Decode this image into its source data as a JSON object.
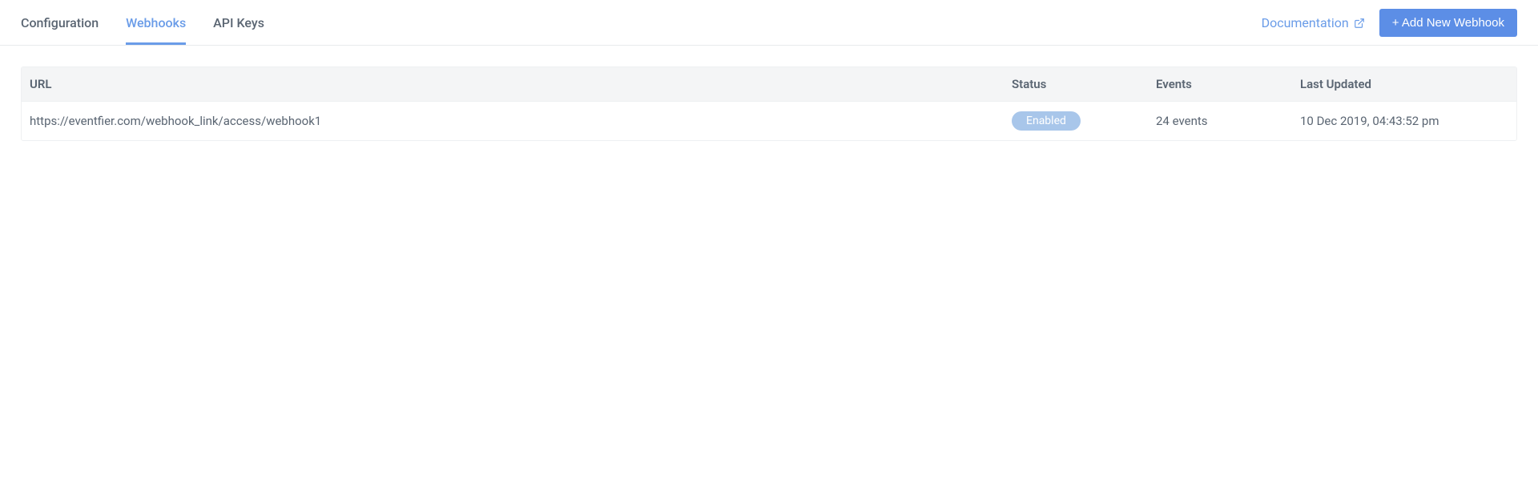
{
  "tabs": {
    "configuration": "Configuration",
    "webhooks": "Webhooks",
    "api_keys": "API Keys"
  },
  "header": {
    "documentation_label": "Documentation",
    "add_button_label": "+ Add New Webhook"
  },
  "table": {
    "headers": {
      "url": "URL",
      "status": "Status",
      "events": "Events",
      "last_updated": "Last Updated"
    },
    "rows": [
      {
        "url": "https://eventfier.com/webhook_link/access/webhook1",
        "status": "Enabled",
        "events": "24 events",
        "last_updated": "10 Dec 2019, 04:43:52 pm"
      }
    ]
  }
}
